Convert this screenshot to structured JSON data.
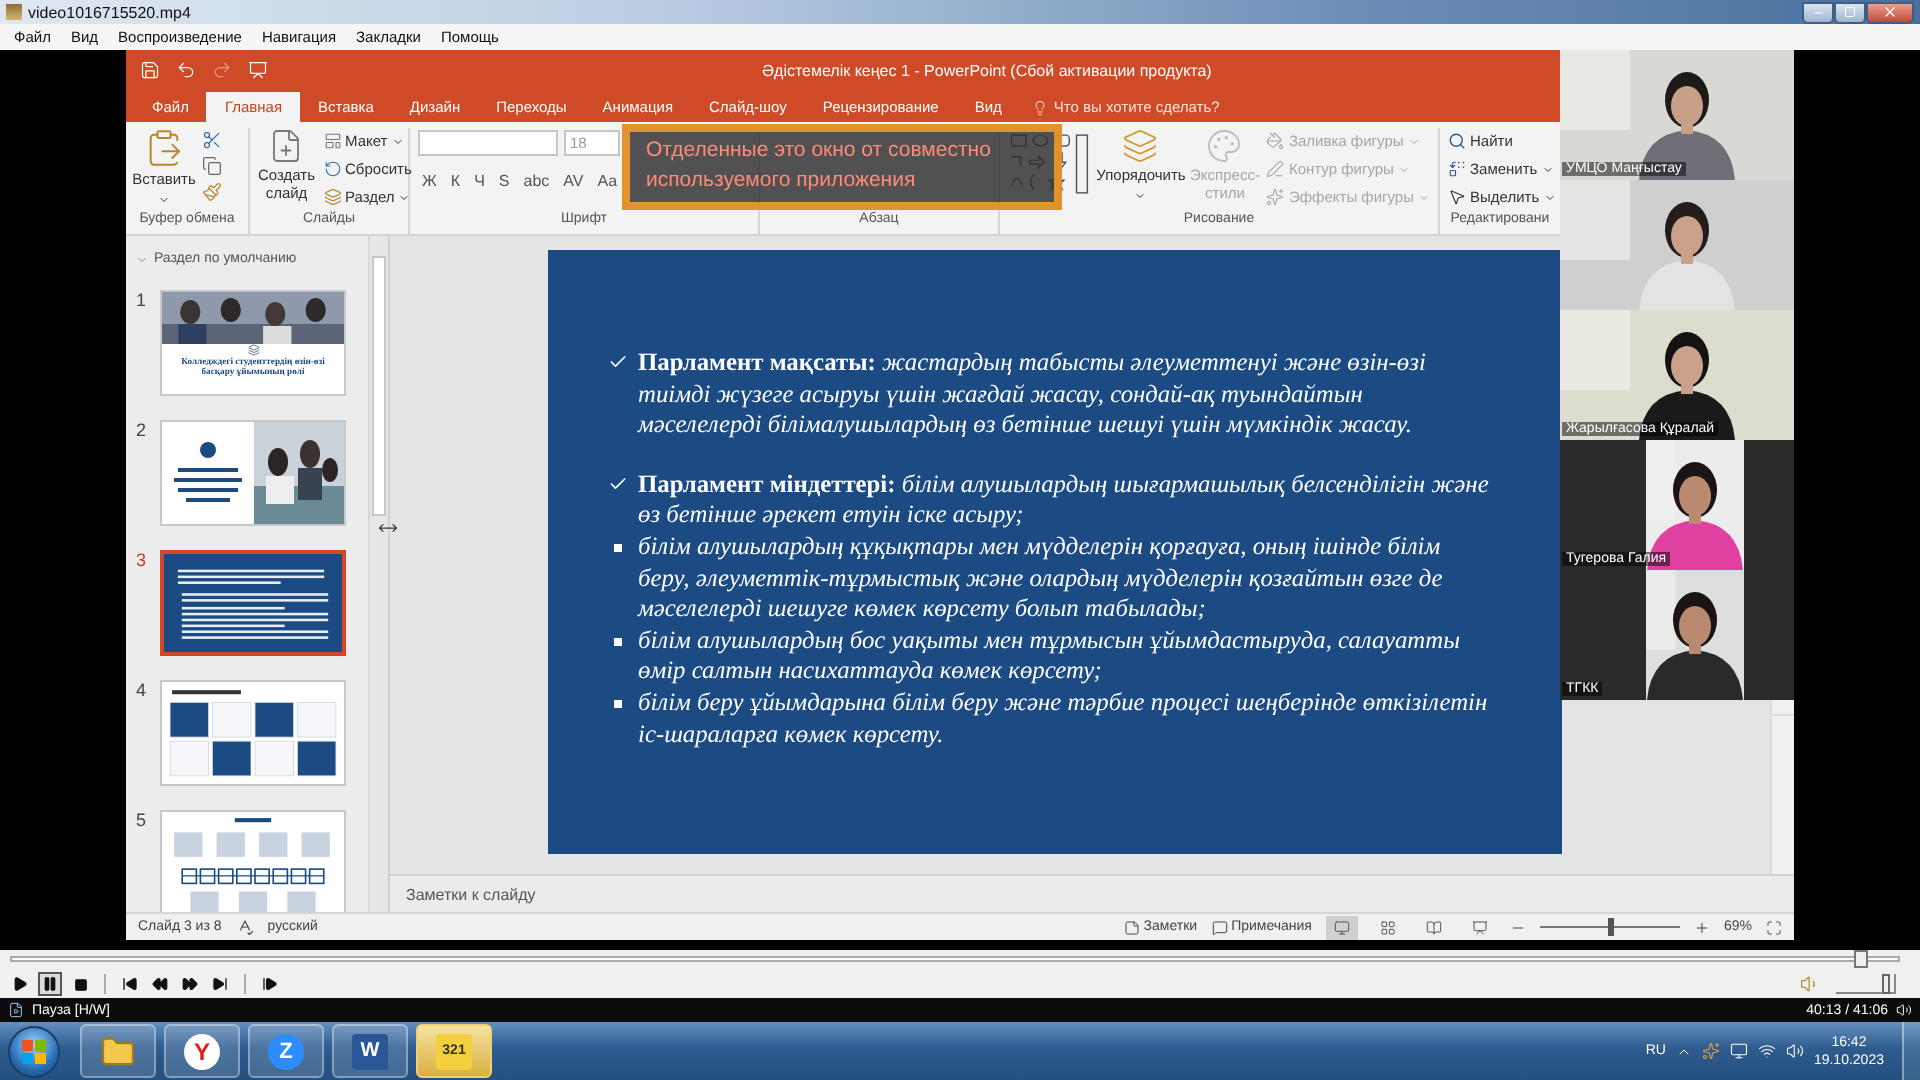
{
  "player": {
    "title": "video1016715520.mp4",
    "menu": [
      "Файл",
      "Вид",
      "Воспроизведение",
      "Навигация",
      "Закладки",
      "Помощь"
    ],
    "seek": {
      "level": 0.98
    },
    "volume": {
      "level": 0.85
    },
    "paused": true,
    "status": "Пауза [H/W]",
    "time": "40:13 / 41:06"
  },
  "powerpoint": {
    "title": "Әдістемелік кеңес 1 - PowerPoint (Сбой активации продукта)",
    "tabs": [
      {
        "label": "Файл",
        "selected": false
      },
      {
        "label": "Главная",
        "selected": true
      },
      {
        "label": "Вставка",
        "selected": false
      },
      {
        "label": "Дизайн",
        "selected": false
      },
      {
        "label": "Переходы",
        "selected": false
      },
      {
        "label": "Анимация",
        "selected": false
      },
      {
        "label": "Слайд-шоу",
        "selected": false
      },
      {
        "label": "Рецензирование",
        "selected": false
      },
      {
        "label": "Вид",
        "selected": false
      }
    ],
    "tell_me": "Что вы хотите сделать?",
    "ribbon": {
      "clipboard": {
        "paste": "Вставить",
        "label": "Буфер обмена"
      },
      "slides": {
        "new_slide": "Создать слайд",
        "layout": "Макет",
        "reset": "Сбросить",
        "section": "Раздел",
        "label": "Слайды"
      },
      "font": {
        "size": "18",
        "buttons": [
          "Ж",
          "К",
          "Ч",
          "S",
          "abc",
          "AV",
          "Aa"
        ],
        "label": "Шрифт"
      },
      "paragraph": {
        "label": "Абзац"
      },
      "drawing": {
        "arrange": "Упорядочить",
        "quick_styles": {
          "label": "Экспресс-стили",
          "disabled": true
        },
        "shape_format": [
          {
            "label": "Заливка фигуры",
            "disabled": true
          },
          {
            "label": "Контур фигуры",
            "disabled": true
          },
          {
            "label": "Эффекты фигуры",
            "disabled": true
          }
        ],
        "label": "Рисование"
      },
      "editing": {
        "find": "Найти",
        "replace": "Заменить",
        "select": "Выделить",
        "label": "Редактировани"
      }
    },
    "section": "Раздел по умолчанию",
    "thumbnails": [
      {
        "number": "1",
        "kind": "title-photo",
        "title": "Колледждегі студенттердің өзін-өзі басқару ұйымының рөлі",
        "selected": false
      },
      {
        "number": "2",
        "kind": "text-photo",
        "selected": false
      },
      {
        "number": "3",
        "kind": "text-blue",
        "selected": true
      },
      {
        "number": "4",
        "kind": "grid",
        "selected": false
      },
      {
        "number": "5",
        "kind": "diagram",
        "selected": false
      }
    ],
    "slide": {
      "items": [
        {
          "kind": "check",
          "text": "**Парламент мақсаты:** жастардың табысты әлеуметтенуі және өзін-өзі тиімді жүзеге асыруы үшін жағдай жасау, сондай-ақ туындайтын мәселелерді білімалушылардың өз бетінше шешуі үшін мүмкіндік жасау."
        },
        {
          "kind": "check",
          "text": "**Парламент міндеттері:** білім алушылардың шығармашылық белсенділігін және өз бетінше әрекет етуін іске асыру;"
        },
        {
          "kind": "square",
          "text": "білім алушылардың құқықтары мен мүдделерін қорғауға, оның ішінде білім беру, әлеуметтік-тұрмыстық және олардың мүдделерін қозғайтын өзге де мәселелерді шешуге көмек көрсету болып табылады;"
        },
        {
          "kind": "square",
          "text": "білім алушылардың бос уақыты мен тұрмысын ұйымдастыруда, салауатты өмір салтын насихаттауда көмек көрсету;"
        },
        {
          "kind": "square",
          "text": "білім беру ұйымдарына білім беру және тәрбие процесі шеңберінде өткізілетін іс-шараларға көмек көрсету."
        }
      ]
    },
    "notes_placeholder": "Заметки к слайду",
    "status": {
      "slide": "Слайд 3 из 8",
      "language": "русский",
      "notes": "Заметки",
      "comments": "Примечания",
      "zoom": "69%",
      "zoom_slider": {
        "level": 0.5
      }
    }
  },
  "share_overlay": {
    "message_lines": [
      "Отделенные это окно от совместно",
      "используемого приложения"
    ]
  },
  "participants": [
    {
      "name": "УМЦО Маңғыстау",
      "letterboxed": false
    },
    {
      "letterboxed": false
    },
    {
      "name": "Жарылғасова Құралай",
      "letterboxed": false
    },
    {
      "name": "Тугерова Галия",
      "letterboxed": true
    },
    {
      "name": "ТГКК",
      "letterboxed": true
    }
  ],
  "taskbar": {
    "apps": [
      {
        "kind": "folder",
        "selected": false
      },
      {
        "kind": "browser",
        "label": "Y",
        "selected": false
      },
      {
        "kind": "meeting",
        "label": "Z",
        "selected": false
      },
      {
        "kind": "document",
        "label": "W",
        "selected": false
      },
      {
        "kind": "player",
        "label": "321",
        "selected": true
      }
    ],
    "language": "RU",
    "time": "16:42",
    "date": "19.10.2023"
  }
}
